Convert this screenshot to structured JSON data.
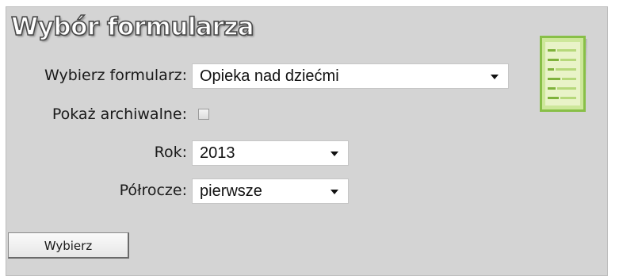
{
  "panel": {
    "title": "Wybór formularza"
  },
  "form": {
    "form_label": "Wybierz formularz:",
    "form_value": "Opieka nad dziećmi",
    "archive_label": "Pokaż archiwalne:",
    "archive_checked": false,
    "year_label": "Rok:",
    "year_value": "2013",
    "half_label": "Półrocze:",
    "half_value": "pierwsze"
  },
  "actions": {
    "submit_label": "Wybierz"
  },
  "icons": {
    "form_icon": "document-form-icon",
    "dropdown_icon": "chevron-down-icon"
  },
  "colors": {
    "panel_bg": "#d4d4d4",
    "icon_green": "#8fc34a",
    "icon_light": "#e9f3c8"
  }
}
